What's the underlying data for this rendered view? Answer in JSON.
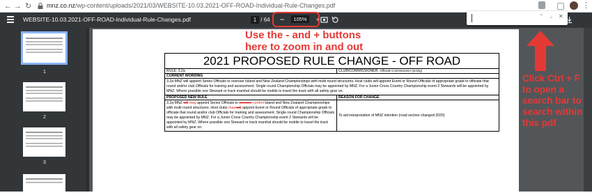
{
  "browser": {
    "back": "←",
    "forward": "→",
    "reload": "↻",
    "url_domain": "mnz.co.nz",
    "url_path": "/wp-content/uploads/2021/03/WEBSITE-10.03.2021-OFF-ROAD-Individual-Rule-Changes.pdf"
  },
  "pdf_toolbar": {
    "title": "WEBSITE-10.03.2021-OFF-ROAD-Individual-Rule-Changes.pdf",
    "current_page": "1",
    "page_sep": "/",
    "total_pages": "64",
    "zoom_out": "−",
    "zoom_value": "105%",
    "zoom_in": "+"
  },
  "find_bar": {
    "value": "",
    "up": "⌃",
    "down": "⌄",
    "close": "✕"
  },
  "thumbnails": [
    {
      "number": "1",
      "selected": true
    },
    {
      "number": "2",
      "selected": false
    },
    {
      "number": "3",
      "selected": false
    }
  ],
  "document": {
    "heading": "2021 PROPOSED RULE CHANGE - OFF ROAD",
    "rule_label": "RULE: 3.2a",
    "club_label": "CLUB/COMMISSIONER:",
    "club_value": "Officials Commissioner (acting)",
    "current_wording_label": "CURRENT WORDING",
    "current_wording": "3.2a  MNZ will appoint Series Officials to oversee Island and New Zealand Championships with multi round structures. Host clubs will appoint Event or Round Officials of appropriate grade to officiate that round and/or club Officials for training and assessment.  Single round Championship Officials may be appointed by MNZ.  For a Junior Cross Country Championship event 2 Stewards will be appointed by MNZ.  Where possible one Steward or track marshal should be mobile to travel the track with all safety gear on.",
    "proposed_rule_label": "PROPOSED NEW RULE",
    "reason_label": "REASON FOR CHANGE",
    "proposed_p1": "3.2a  MNZ ",
    "proposed_strike1": "will",
    "proposed_ins1": " may",
    "proposed_p2": " appoint Series Officials to ",
    "proposed_strike2": "oversee",
    "proposed_ins2": " control",
    "proposed_p3": " Island and New Zealand Championships with multi round structures. Host clubs ",
    "proposed_ins3": "may",
    "proposed_strike3": " will",
    "proposed_p4": " appoint Event or Round Officials of appropriate grade to officiate that round and/or club Officials for training and assessment.  Single round Championship Officials may be appointed by MNZ.  For a Junior Cross Country Championship event 2 Stewards will be appointed by MNZ.  Where possible one Steward or track marshal should be mobile to travel the track with all safety gear on.",
    "reason_value": "To aid interpretation of MNZ intention (road section changed 2020)"
  },
  "annotations": {
    "zoom_note_line1": "Use the - and + buttons",
    "zoom_note_line2": "here to zoom in and out",
    "find_note": "Click Ctrl + F to open a search bar to search within this pdf",
    "color": "#e53935"
  }
}
